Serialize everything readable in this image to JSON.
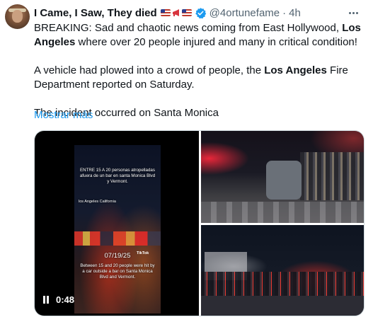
{
  "author": {
    "display_name": "I Came, I Saw, They died",
    "handle": "@4ortunefame",
    "time": "4h",
    "flags": [
      "us-flag-icon",
      "megaphone-icon",
      "us-flag-icon"
    ],
    "verified": true
  },
  "tweet": {
    "p1_a": "BREAKING: Sad and chaotic news coming from East Hollywood, ",
    "p1_b": "Los Angeles",
    "p1_c": " where over 20 people injured and many in critical condition!",
    "p2_a": "A vehicle had plowed into a crowd of people, the ",
    "p2_b": "Los Angeles",
    "p2_c": " Fire Department reported on Saturday.",
    "p3": "The incident occurred on Santa Monica",
    "show_more": "Mostrar más"
  },
  "media": {
    "video": {
      "duration": "0:48",
      "overlay_top": "ENTRE 15 A 20 personas atropelladas afuera de un bar en santa Monica Blvd y Vermont.",
      "overlay_city": "los Angeles California",
      "overlay_date": "07/19/25",
      "overlay_bottom": "Between 15 and 20 people were hit by a car outside a bar on Santa Monica Blvd and Vermont.",
      "watermark": "TikTok"
    }
  },
  "colors": {
    "link": "#1d9bf0",
    "secondary_text": "#536471",
    "verified": "#1d9bf0"
  }
}
